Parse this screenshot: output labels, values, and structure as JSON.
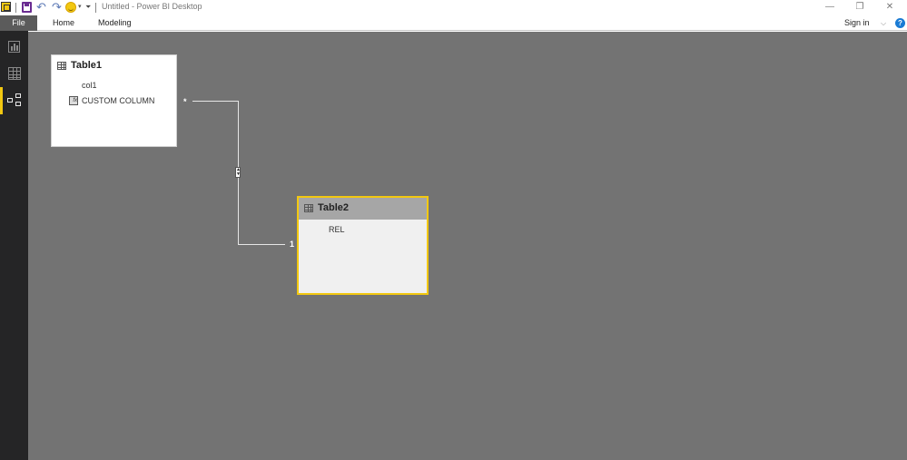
{
  "window": {
    "title": "Untitled - Power BI Desktop",
    "controls": {
      "minimize": "—",
      "restore": "❐",
      "close": "✕"
    }
  },
  "quick_access": {
    "icons": [
      "app-icon",
      "save-icon",
      "undo-icon",
      "redo-icon",
      "feedback-smile-icon",
      "customize-toolbar-icon"
    ],
    "undo_glyph": "↶",
    "redo_glyph": "↷",
    "dropdown_glyph": "▾",
    "customize_glyph": "⏷"
  },
  "ribbon": {
    "tabs": [
      {
        "label": "File",
        "active": true
      },
      {
        "label": "Home"
      },
      {
        "label": "Modeling"
      }
    ],
    "sign_in": "Sign in",
    "chevron": "⌵",
    "help": "?"
  },
  "nav": {
    "items": [
      {
        "name": "report-view",
        "active": false
      },
      {
        "name": "data-view",
        "active": false
      },
      {
        "name": "relationships-view",
        "active": true
      }
    ]
  },
  "model": {
    "tables": [
      {
        "name": "Table1",
        "selected": false,
        "fields": [
          {
            "name": "col1",
            "type": "column"
          },
          {
            "name": "CUSTOM COLUMN",
            "type": "calculated-column",
            "icon_glyph": "fx"
          }
        ]
      },
      {
        "name": "Table2",
        "selected": true,
        "fields": [
          {
            "name": "REL",
            "type": "column"
          }
        ]
      }
    ],
    "relationship": {
      "from_table": "Table1",
      "to_table": "Table2",
      "from_cardinality": "*",
      "to_cardinality": "1",
      "cross_filter": "both"
    }
  },
  "colors": {
    "accent": "#f2c811",
    "canvas": "#737373",
    "nav_bg": "#252526",
    "file_tab": "#5b5b5b",
    "help": "#1a7bd4"
  }
}
